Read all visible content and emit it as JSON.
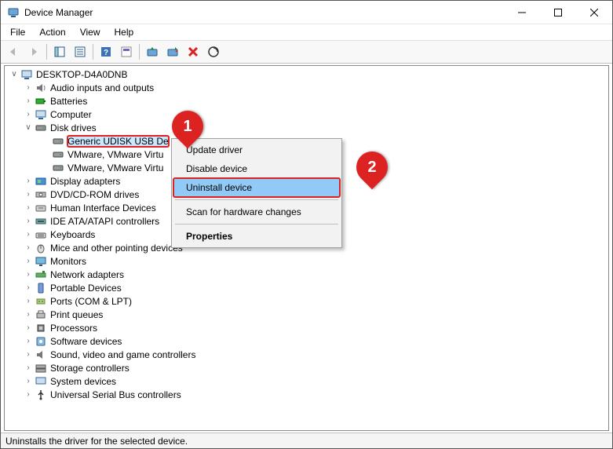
{
  "title": "Device Manager",
  "menu": {
    "file": "File",
    "action": "Action",
    "view": "View",
    "help": "Help"
  },
  "status": "Uninstalls the driver for the selected device.",
  "callout": {
    "one": "1",
    "two": "2"
  },
  "context": {
    "update": "Update driver",
    "disable": "Disable device",
    "uninstall": "Uninstall device",
    "scan": "Scan for hardware changes",
    "properties": "Properties"
  },
  "tree": {
    "root": "DESKTOP-D4A0DNB",
    "audio": "Audio inputs and outputs",
    "batteries": "Batteries",
    "computer": "Computer",
    "disk": "Disk drives",
    "disk_children": {
      "generic": "Generic UDISK USB De",
      "vm1": "VMware, VMware Virtu",
      "vm2": "VMware, VMware Virtu"
    },
    "display": "Display adapters",
    "dvd": "DVD/CD-ROM drives",
    "hid": "Human Interface Devices",
    "ide": "IDE ATA/ATAPI controllers",
    "keyboards": "Keyboards",
    "mice": "Mice and other pointing devices",
    "monitors": "Monitors",
    "network": "Network adapters",
    "portable": "Portable Devices",
    "ports": "Ports (COM & LPT)",
    "printqueues": "Print queues",
    "processors": "Processors",
    "software": "Software devices",
    "sound": "Sound, video and game controllers",
    "storage": "Storage controllers",
    "system": "System devices",
    "usb": "Universal Serial Bus controllers"
  }
}
